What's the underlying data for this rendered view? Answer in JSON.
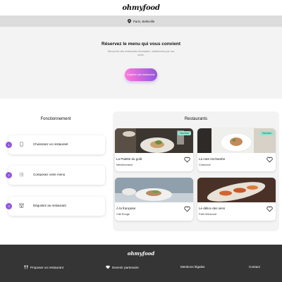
{
  "header": {
    "logo": "ohmyfood"
  },
  "location": {
    "icon": "location-pin-icon",
    "text": "Paris, Belleville"
  },
  "hero": {
    "title": "Réservez le menu qui vous convient",
    "subtitle": "Découvrez des restaurants d'exception, sélectionnés par nos soins.",
    "cta_label": "Explorer nos restaurants"
  },
  "fonctionnement": {
    "title": "Fonctionnement",
    "steps": [
      {
        "number": "1",
        "icon": "phone-icon",
        "label": "Choisissez un restaurant"
      },
      {
        "number": "2",
        "icon": "list-icon",
        "label": "Composez votre menu"
      },
      {
        "number": "3",
        "icon": "store-icon",
        "label": "Dégustez au restaurant"
      }
    ]
  },
  "restaurants": {
    "title": "Restaurants",
    "new_badge": "Nouveau",
    "cards": [
      {
        "name": "La Palette du goût",
        "area": "Ménilmontant",
        "is_new": true
      },
      {
        "name": "La note enchantée",
        "area": "Charonne",
        "is_new": true
      },
      {
        "name": "À la française",
        "area": "Cité Rouge",
        "is_new": false
      },
      {
        "name": "Le délice des sens",
        "area": "Folie Méricourt",
        "is_new": false
      }
    ]
  },
  "footer": {
    "logo": "ohmyfood",
    "links": [
      {
        "icon": "utensils-icon",
        "label": "Proposer un restaurant"
      },
      {
        "icon": "heart-handshake-icon",
        "label": "Devenir partenaire"
      },
      {
        "icon": "",
        "label": "Mentions légales"
      },
      {
        "icon": "",
        "label": "Contact"
      }
    ]
  },
  "colors": {
    "accent_start": "#ff79da",
    "accent_end": "#9356dc",
    "badge": "#99e2d0",
    "footer_bg": "#353535"
  }
}
